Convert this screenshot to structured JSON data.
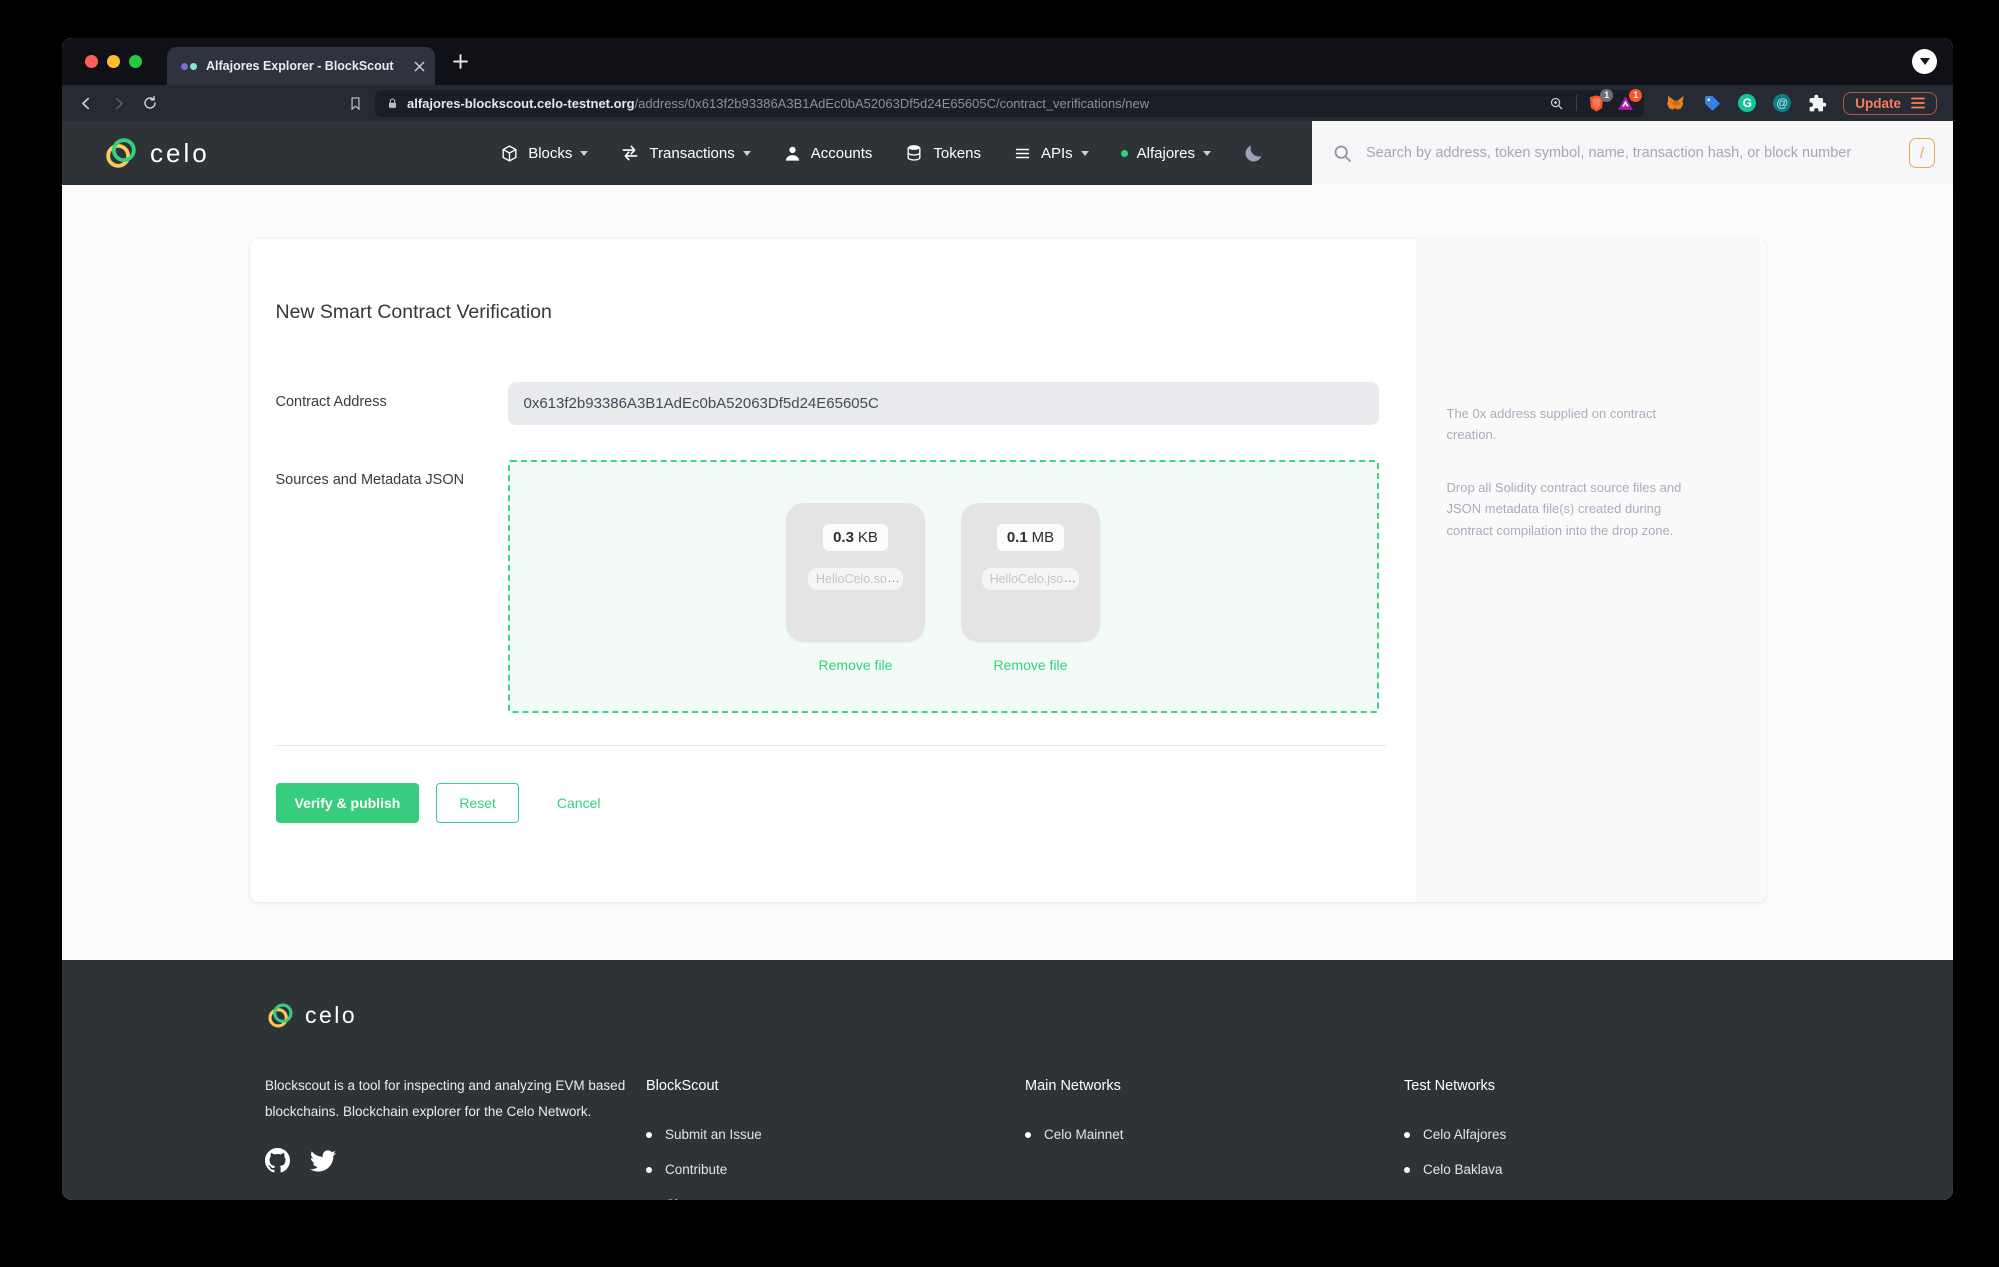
{
  "browser": {
    "tab_title": "Alfajores Explorer - BlockScout",
    "url_domain": "alfajores-blockscout.celo-testnet.org",
    "url_path": "/address/0x613f2b93386A3B1AdEc0bA52063Df5d24E65605C/contract_verifications/new",
    "shield_badge": "1",
    "rewards_badge": "1",
    "update_label": "Update"
  },
  "navbar": {
    "brand": "celo",
    "items": [
      {
        "label": "Blocks"
      },
      {
        "label": "Transactions"
      },
      {
        "label": "Accounts"
      },
      {
        "label": "Tokens"
      },
      {
        "label": "APIs"
      },
      {
        "label": "Alfajores"
      }
    ],
    "search_placeholder": "Search by address, token symbol, name, transaction hash, or block number",
    "search_shortcut": "/"
  },
  "page": {
    "title": "New Smart Contract Verification",
    "address_label": "Contract Address",
    "address_value": "0x613f2b93386A3B1AdEc0bA52063Df5d24E65605C",
    "address_help": "The 0x address supplied on contract creation.",
    "sources_label": "Sources and Metadata JSON",
    "sources_help": "Drop all Solidity contract source files and JSON metadata file(s) created during contract compilation into the drop zone.",
    "files": [
      {
        "size_value": "0.3",
        "size_unit": "KB",
        "name": "HelloCelo.so",
        "ellipsis": "...",
        "remove_label": "Remove file"
      },
      {
        "size_value": "0.1",
        "size_unit": "MB",
        "name": "HelloCelo.jso",
        "ellipsis": "...",
        "remove_label": "Remove file"
      }
    ],
    "submit_label": "Verify & publish",
    "reset_label": "Reset",
    "cancel_label": "Cancel"
  },
  "footer": {
    "brand": "celo",
    "description": "Blockscout is a tool for inspecting and analyzing EVM based blockchains. Blockchain explorer for the Celo Network.",
    "columns": [
      {
        "title": "BlockScout",
        "items": [
          "Submit an Issue",
          "Contribute",
          "Chat"
        ]
      },
      {
        "title": "Main Networks",
        "items": [
          "Celo Mainnet"
        ]
      },
      {
        "title": "Test Networks",
        "items": [
          "Celo Alfajores",
          "Celo Baklava"
        ]
      }
    ]
  },
  "colors": {
    "celo_green": "#35D07F",
    "celo_gold": "#FBCC5C",
    "dark_bg": "#2E3338"
  }
}
